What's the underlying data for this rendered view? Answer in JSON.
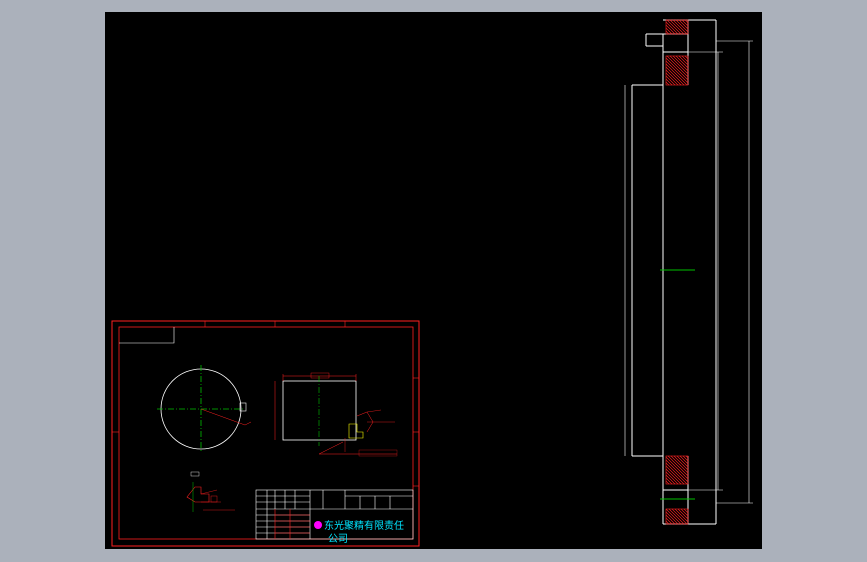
{
  "drawing": {
    "title_block": {
      "company_line1": "东光聚精有限责任",
      "company_line2": "公司"
    }
  },
  "colors": {
    "background": "#abb1bb",
    "canvas": "#000000",
    "frame": "#ff2020",
    "geometry": "#ffffff",
    "centerline": "#00c000",
    "company_text": "#00e5ff",
    "logo_dot": "#ff00ff"
  }
}
